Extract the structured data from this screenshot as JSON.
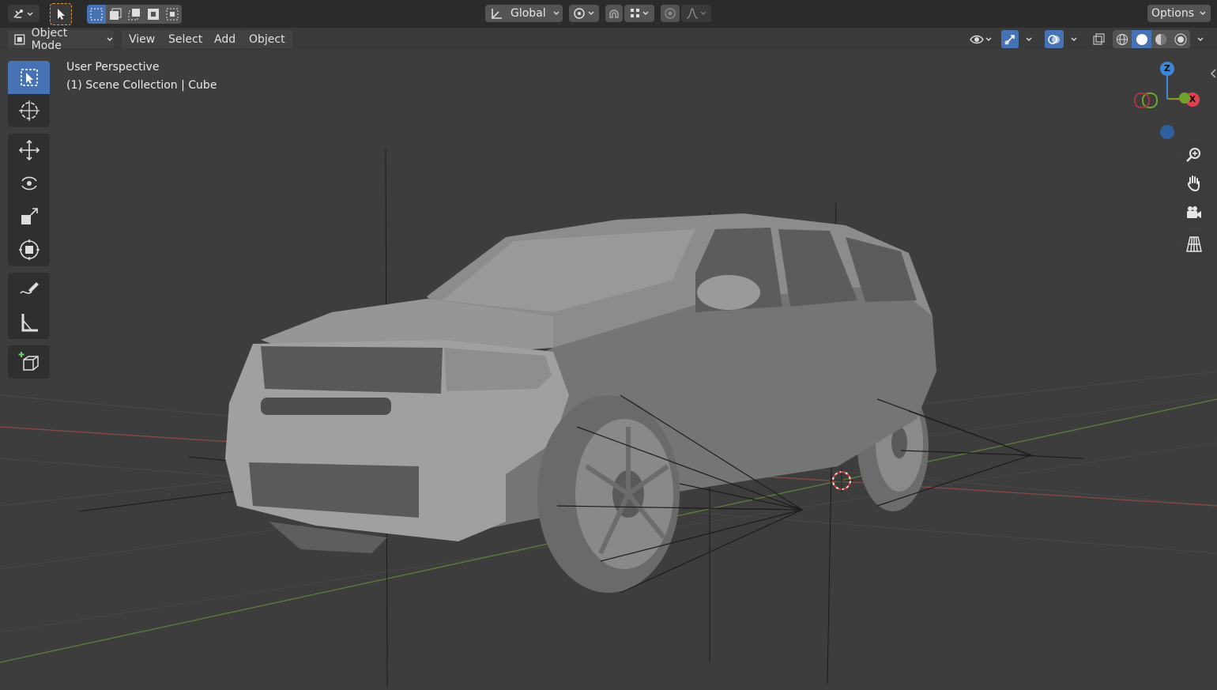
{
  "top_bar": {
    "editor_type_icon": "editor-type-icon",
    "transform_orientation": "Global",
    "options_label": "Options"
  },
  "header": {
    "mode_label": "Object Mode",
    "menus": [
      "View",
      "Select",
      "Add",
      "Object"
    ]
  },
  "viewport": {
    "perspective_label": "User Perspective",
    "collection_label": "(1) Scene Collection | Cube"
  },
  "gizmo": {
    "z_label": "Z",
    "x_label": "X"
  },
  "toolbar": {
    "tools": [
      "select-box",
      "cursor",
      "move",
      "rotate",
      "scale",
      "transform",
      "annotate",
      "measure",
      "add-cube"
    ],
    "active_tool": "select-box"
  },
  "colors": {
    "background": "#3d3d3d",
    "active_tool": "#4772b3",
    "axis_x": "#e0404f",
    "axis_y": "#6fa32c",
    "axis_z": "#3f86d6"
  }
}
